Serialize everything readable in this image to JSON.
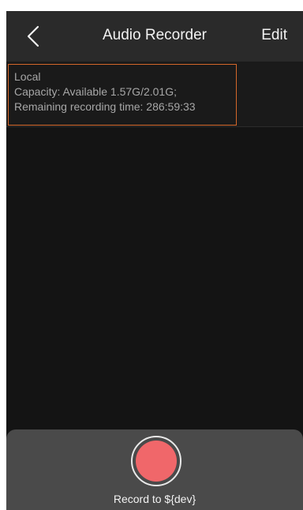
{
  "nav": {
    "back_icon": "chevron-left-icon",
    "title": "Audio Recorder",
    "edit_label": "Edit"
  },
  "storage": {
    "name": "Local",
    "capacity": "Capacity: Available 1.57G/2.01G;",
    "remaining": "Remaining recording time: 286:59:33",
    "highlight_color": "#d4672a"
  },
  "recorder": {
    "button_icon": "record-button-icon",
    "button_color": "#f0676a",
    "label": "Record to ${dev}"
  }
}
